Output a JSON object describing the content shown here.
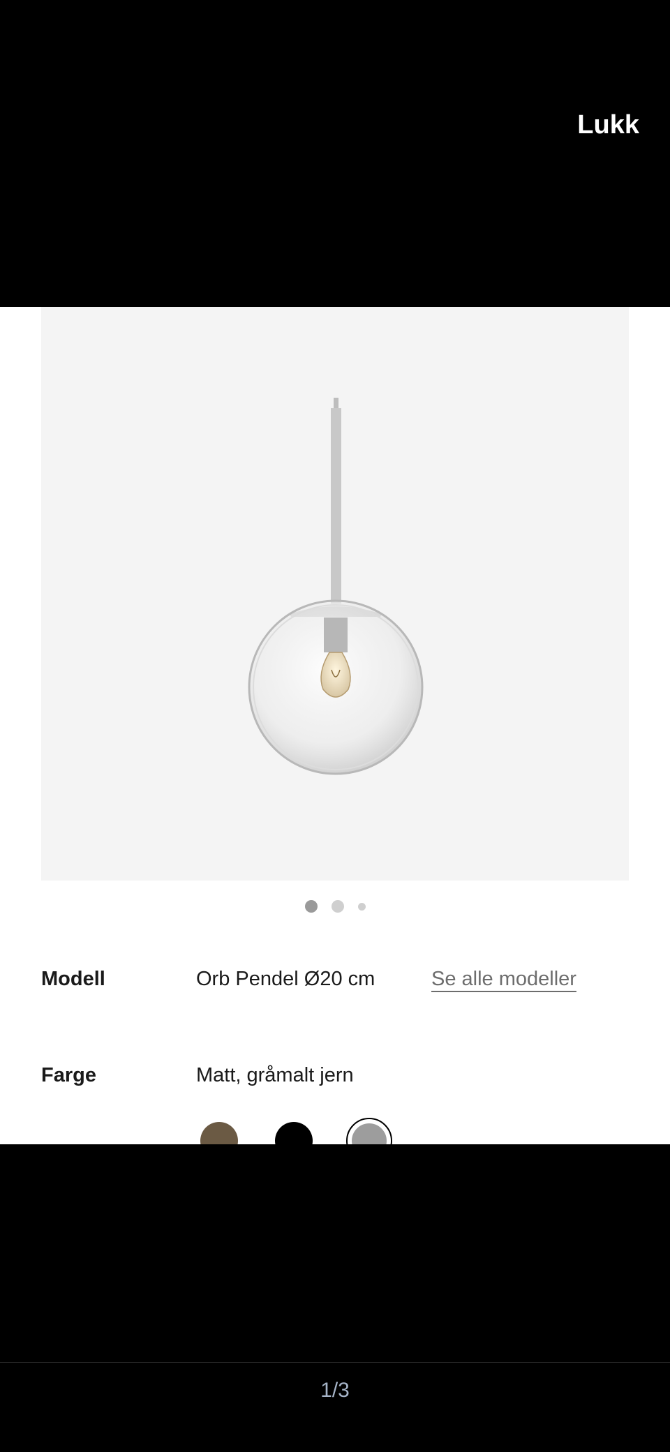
{
  "header": {
    "close_label": "Lukk"
  },
  "gallery": {
    "total_slides": 3,
    "active_index": 0
  },
  "product": {
    "model_label": "Modell",
    "model_value": "Orb Pendel Ø20 cm",
    "see_all_label": "Se alle modeller",
    "color_label": "Farge",
    "color_value": "Matt, gråmalt jern",
    "swatches": [
      {
        "name": "bronze",
        "color": "#6b5a44"
      },
      {
        "name": "black",
        "color": "#000000"
      },
      {
        "name": "grey",
        "color": "#9d9d9d",
        "selected": true
      }
    ]
  },
  "footer": {
    "counter": "1/3"
  }
}
